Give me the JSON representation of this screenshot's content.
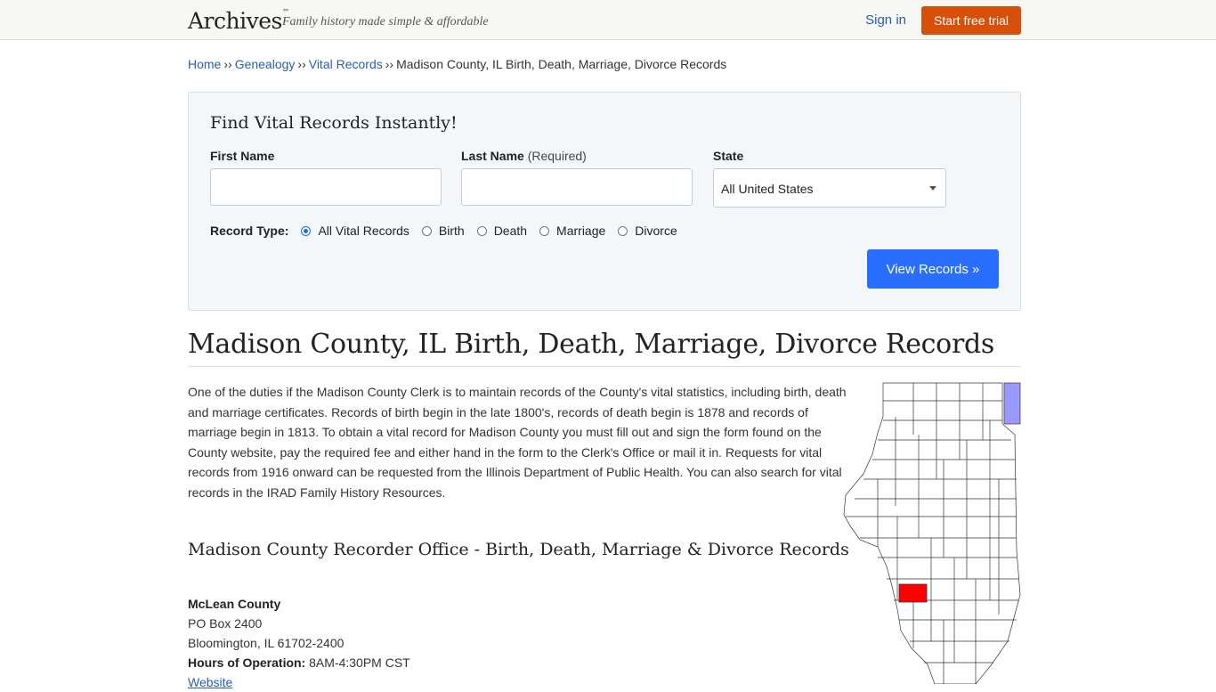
{
  "header": {
    "logo": "Archives",
    "logo_tm": "™",
    "tagline": "Family history made simple & affordable",
    "signin": "Sign in",
    "trial_button": "Start free trial",
    "trial_color": "#d64f0b"
  },
  "breadcrumb": {
    "home": "Home",
    "genealogy": "Genealogy",
    "vital": "Vital Records",
    "current": "Madison County, IL Birth, Death, Marriage, Divorce Records",
    "separator": "››"
  },
  "search": {
    "title": "Find Vital Records Instantly!",
    "first_name_label": "First Name",
    "last_name_label": "Last Name",
    "last_name_required": "(Required)",
    "state_label": "State",
    "state_value": "All United States",
    "record_type_label": "Record Type:",
    "record_types": [
      "All Vital Records",
      "Birth",
      "Death",
      "Marriage",
      "Divorce"
    ],
    "selected_record_type": "All Vital Records",
    "submit": "View Records »",
    "submit_color": "#2a6eff"
  },
  "page": {
    "title": "Madison County, IL Birth, Death, Marriage, Divorce Records",
    "intro": "One of the duties if the Madison County Clerk is to maintain records of the County's vital statistics, including birth, death and marriage certificates. Records of birth begin in the late 1800's, records of death begin is 1878 and records of marriage begin in 1813. To obtain a vital record for Madison County you must fill out and sign the form found on the County website, pay the required fee and either hand in the form to the Clerk's Office or mail it in. Requests for vital records from 1916 onward can be requested from the Illinois Department of Public Health. You can also search for vital records in the IRAD Family History Resources.",
    "section_title": "Madison County Recorder Office - Birth, Death, Marriage & Divorce Records"
  },
  "office": {
    "name": "McLean County",
    "address1": "PO Box 2400",
    "address2": "Bloomington, IL 61702-2400",
    "hours_label": "Hours of Operation:",
    "hours": "8AM-4:30PM CST",
    "website": "Website"
  },
  "map": {
    "highlight_color": "#ff0000",
    "lake_color": "#9999ff",
    "icon": "illinois-county-map"
  }
}
